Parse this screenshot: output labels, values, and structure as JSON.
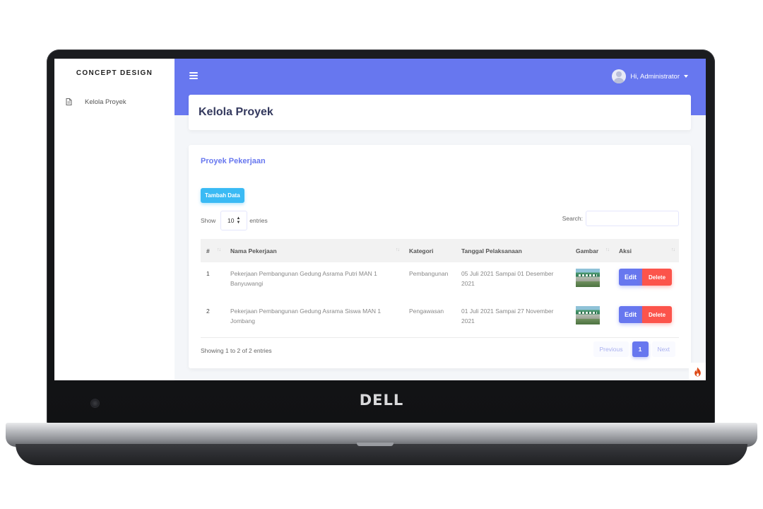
{
  "sidebar": {
    "brand": "CONCEPT DESIGN",
    "items": [
      {
        "label": "Kelola Proyek",
        "icon": "document-icon"
      }
    ]
  },
  "topbar": {
    "menu_icon": "hamburger-icon",
    "user_label": "Hi, Administrator"
  },
  "page": {
    "title": "Kelola Proyek"
  },
  "card": {
    "title": "Proyek Pekerjaan",
    "add_button": "Tambah Data",
    "show_label": "Show",
    "entries_value": "10",
    "entries_label": "entries",
    "search_label": "Search:",
    "search_value": ""
  },
  "table": {
    "columns": [
      "#",
      "Nama Pekerjaan",
      "Kategori",
      "Tanggal Pelaksanaan",
      "Gambar",
      "Aksi"
    ],
    "rows": [
      {
        "no": "1",
        "nama": "Pekerjaan Pembangunan Gedung Asrama Putri MAN 1 Banyuwangi",
        "kategori": "Pembangunan",
        "tanggal": "05 Juli 2021 Sampai 01 Desember 2021",
        "edit": "Edit",
        "delete": "Delete"
      },
      {
        "no": "2",
        "nama": "Pekerjaan Pembangunan Gedung Asrama Siswa MAN 1 Jombang",
        "kategori": "Pengawasan",
        "tanggal": "01 Juli 2021 Sampai 27 November 2021",
        "edit": "Edit",
        "delete": "Delete"
      }
    ]
  },
  "footer": {
    "info": "Showing 1 to 2 of 2 entries",
    "previous": "Previous",
    "current_page": "1",
    "next": "Next"
  },
  "device": {
    "logo": "DELL"
  },
  "colors": {
    "primary": "#6777ef",
    "info": "#3abaf4",
    "danger": "#fc544b",
    "title": "#34395e"
  }
}
